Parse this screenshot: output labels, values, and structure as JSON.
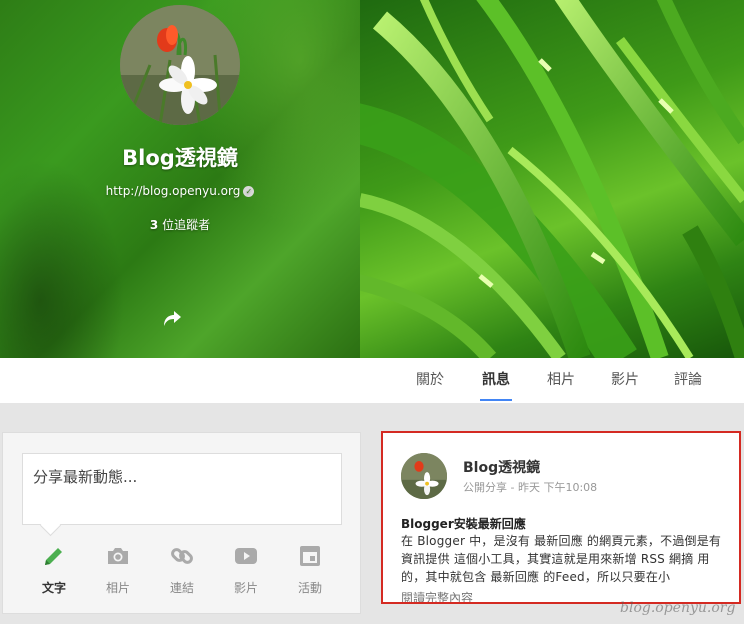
{
  "profile": {
    "name": "Blog透視鏡",
    "url": "http://blog.openyu.org",
    "followers_count": "3",
    "followers_suffix": " 位追蹤者"
  },
  "tabs": [
    {
      "label": "關於",
      "active": false
    },
    {
      "label": "訊息",
      "active": true
    },
    {
      "label": "相片",
      "active": false
    },
    {
      "label": "影片",
      "active": false
    },
    {
      "label": "評論",
      "active": false
    }
  ],
  "share_box": {
    "placeholder": "分享最新動態...",
    "actions": [
      {
        "label": "文字",
        "icon": "pencil-icon",
        "active": true
      },
      {
        "label": "相片",
        "icon": "camera-icon",
        "active": false
      },
      {
        "label": "連結",
        "icon": "link-icon",
        "active": false
      },
      {
        "label": "影片",
        "icon": "video-play-icon",
        "active": false
      },
      {
        "label": "活動",
        "icon": "event-icon",
        "active": false
      }
    ]
  },
  "post": {
    "author": "Blog透視鏡",
    "visibility": "公開分享",
    "separator": " - ",
    "time": "昨天 下午10:08",
    "title": "Blogger安裝最新回應",
    "body": "在 Blogger 中，是沒有 最新回應 的網頁元素，不過倒是有 資訊提供 這個小工具，其實這就是用來新增 RSS 網摘 用的，其中就包含 最新回應 的Feed，所以只要在小",
    "read_more": "閱讀完整內容"
  },
  "watermark": "blog.openyu.org",
  "colors": {
    "accent": "#4285f4",
    "highlight_border": "#d42a22",
    "pencil": "#4caf50"
  }
}
